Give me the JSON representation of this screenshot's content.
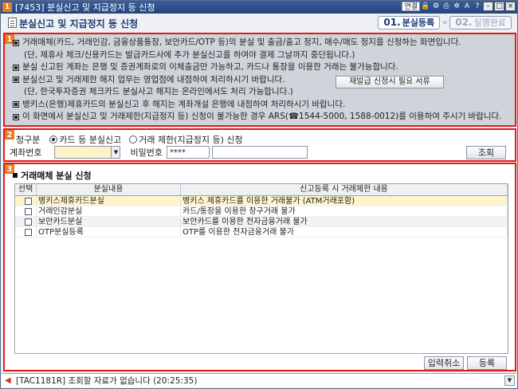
{
  "titlebar": {
    "badge": "1",
    "title": "[7453] 분실신고 및 지급정지 등 신청",
    "link_label": "연결",
    "icons": [
      "lock-icon",
      "gear-icon",
      "printer-icon",
      "settings-icon",
      "help-icon"
    ],
    "icon_glyphs": [
      "🔒",
      "⚙",
      "⎙",
      "✲",
      "A",
      "?"
    ],
    "controls": [
      "–",
      "□",
      "×"
    ]
  },
  "header": {
    "title": "분실신고 및 지급정지 등 신청",
    "steps": [
      {
        "num": "01.",
        "label": "분실등록"
      },
      {
        "num": "02.",
        "label": "실행완료"
      }
    ],
    "step_sep": "»"
  },
  "notice": {
    "marker": "1",
    "lines": [
      "거래매체(카드, 거래인감, 금융상품통장, 보안카드/OTP 등)의 분실 및 출금/출고 정지, 매수/매도 정지를 신청하는 화면입니다.",
      "(단, 제휴사 체크/신용카드는 발급카드사에 추가 분실신고를 하여야 결제 그날까지 중단됩니다.)",
      "분실 신고된 계좌는 은행 및 증권계좌로의 이체출금만 가능하고, 카드나 통장을 이용한 거래는 불가능합니다.",
      "분실신고 및 거래제한 해지 업무는 영업점에 내점하여 처리하시기 바랍니다.",
      "(단, 한국투자증권 체크카드 분실사고 해지는 온라인에서도 처리 가능합니다.)",
      "뱅키스(은행)제휴카드의 분실신고 후 해지는 계좌개설 은행에 내점하여 처리하시기 바랍니다.",
      "이 화면에서 분실신고 및 거래제한(지급정지 등) 신청이 불가능한 경우 ARS(☎1544-5000, 1588-0012)를 이용하여 주시기 바랍니다."
    ],
    "reissue_button": "재발급 신청시 필요 서류"
  },
  "form": {
    "marker": "2",
    "request_type_label": "청구분",
    "options": [
      "카드 등 분실신고",
      "거래 제한(지급정지 등) 신청"
    ],
    "selected_option": 0,
    "account_label": "계좌번호",
    "account_value": "",
    "password_label": "비밀번호",
    "password_value": "****",
    "extra_value": "",
    "search_button": "조회"
  },
  "main": {
    "marker": "3",
    "section_title": "거래매체 분실 신청",
    "columns": [
      "선택",
      "분실내용",
      "신고등록 시 거래제한 내용"
    ],
    "rows": [
      {
        "content": "뱅키스제휴카드분실",
        "restriction": "뱅키스 제휴카드를 이용한 거래불가 (ATM거래포함)"
      },
      {
        "content": "거래인감분실",
        "restriction": "카드/통장을 이용한 창구거래 불가"
      },
      {
        "content": "보안카드분실",
        "restriction": "보안카드를 이용한 전자금융거래 불가"
      },
      {
        "content": "OTP분실등록",
        "restriction": "OTP를 이용한 전자금융거래 불가"
      }
    ],
    "cancel_button": "입력취소",
    "register_button": "등록"
  },
  "status": {
    "message": "[TAC1181R] 조회할 자료가 없습니다 (20:25:35)"
  },
  "colors": {
    "highlight_box": "#e11a1a",
    "marker": "#e87c1e",
    "titlebar": "#2b4f8c",
    "row_highlight": "#fff5cc"
  }
}
